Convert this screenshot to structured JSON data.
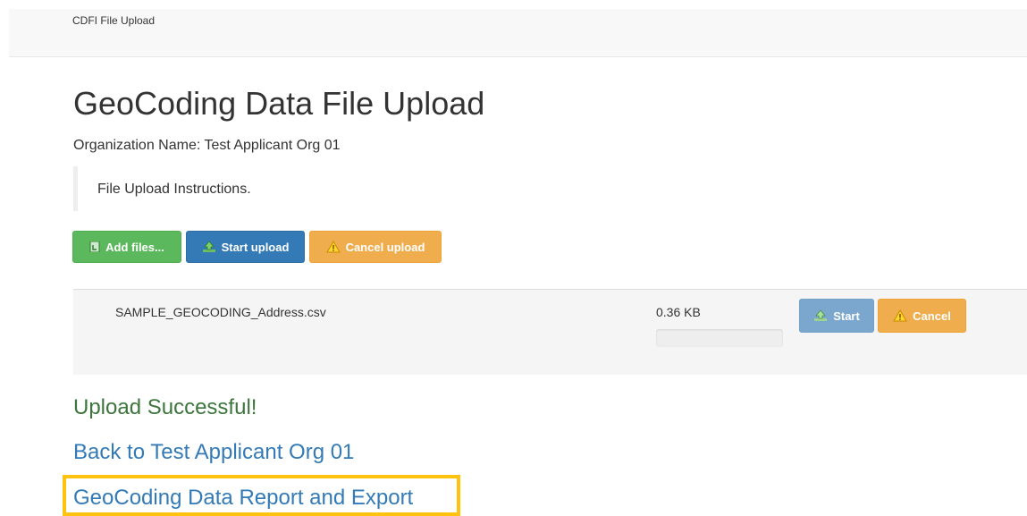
{
  "navbar": {
    "brand": "CDFI File Upload"
  },
  "page": {
    "title": "GeoCoding Data File Upload",
    "org_line": "Organization Name: Test Applicant Org 01",
    "instructions": "File Upload Instructions."
  },
  "toolbar": {
    "add_files_label": "Add files...",
    "start_upload_label": "Start upload",
    "cancel_upload_label": "Cancel upload"
  },
  "files": [
    {
      "name": "SAMPLE_GEOCODING_Address.csv",
      "size": "0.36 KB",
      "progress_fraction": 0,
      "start_label": "Start",
      "cancel_label": "Cancel"
    }
  ],
  "status": {
    "message": "Upload Successful!"
  },
  "links": {
    "back": "Back to Test Applicant Org 01",
    "report": "GeoCoding Data Report and Export"
  },
  "colors": {
    "success": "#5cb85c",
    "primary": "#337ab7",
    "warning": "#f0ad4e",
    "success_text": "#3c763d",
    "link": "#337ab7",
    "highlight": "#ffc20e"
  },
  "icons": {
    "add_files": "add-file-icon",
    "upload": "upload-icon",
    "cancel": "warning-icon"
  }
}
